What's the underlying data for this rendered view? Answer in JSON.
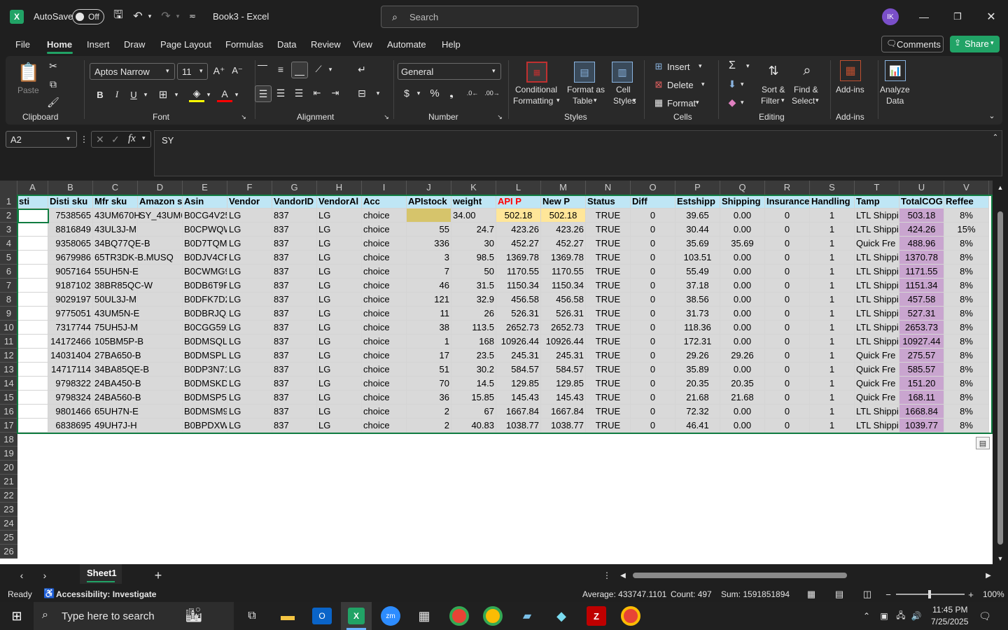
{
  "titlebar": {
    "autosave_label": "AutoSave",
    "autosave_state": "Off",
    "doc_title": "Book3  -  Excel",
    "search_placeholder": "Search",
    "avatar_initials": "IK"
  },
  "menu": {
    "tabs": [
      "File",
      "Home",
      "Insert",
      "Draw",
      "Page Layout",
      "Formulas",
      "Data",
      "Review",
      "View",
      "Automate",
      "Help"
    ],
    "active": "Home",
    "comments_label": "Comments",
    "share_label": "Share"
  },
  "ribbon": {
    "clipboard": {
      "paste": "Paste",
      "group": "Clipboard"
    },
    "font": {
      "name": "Aptos Narrow",
      "size": "11",
      "group": "Font"
    },
    "alignment": {
      "group": "Alignment"
    },
    "number": {
      "format": "General",
      "group": "Number"
    },
    "styles": {
      "conditional_1": "Conditional",
      "conditional_2": "Formatting",
      "format_table_1": "Format as",
      "format_table_2": "Table",
      "cell_styles_1": "Cell",
      "cell_styles_2": "Styles",
      "group": "Styles"
    },
    "cells": {
      "insert": "Insert",
      "delete": "Delete",
      "format": "Format",
      "group": "Cells"
    },
    "editing": {
      "sort_1": "Sort &",
      "sort_2": "Filter",
      "find_1": "Find &",
      "find_2": "Select",
      "group": "Editing"
    },
    "addins": {
      "label": "Add-ins",
      "group": "Add-ins"
    },
    "analyze": {
      "label_1": "Analyze",
      "label_2": "Data"
    }
  },
  "formula_bar": {
    "name_box": "A2",
    "formula": "SY"
  },
  "columns": [
    "A",
    "B",
    "C",
    "D",
    "E",
    "F",
    "G",
    "H",
    "I",
    "J",
    "K",
    "L",
    "M",
    "N",
    "O",
    "P",
    "Q",
    "R",
    "S",
    "T",
    "U",
    "V"
  ],
  "headers": [
    "sti",
    "Disti sku",
    "Mfr sku",
    "Amazon s",
    "Asin",
    "Vendor",
    "VandorID",
    "VendorAl",
    "Acc",
    "APIstock",
    "weight",
    "API P",
    "New P",
    "Status",
    "Diff",
    "Estshipp",
    "Shipping",
    "Insurance",
    "Handling",
    "Tamp",
    "TotalCOG",
    "Reffee"
  ],
  "rows": [
    [
      "",
      "7538565",
      "43UM670H",
      "SY_43UM6",
      "B0CG4V25",
      "LG",
      "837",
      "LG",
      "choice",
      "",
      "34.00",
      "502.18",
      "502.18",
      "TRUE",
      "0",
      "39.65",
      "0.00",
      "0",
      "1",
      "LTL Shippi",
      "503.18",
      "8%"
    ],
    [
      "",
      "8816849",
      "43UL3J-M",
      "",
      "B0CPWQW",
      "LG",
      "837",
      "LG",
      "choice",
      "55",
      "24.7",
      "423.26",
      "423.26",
      "TRUE",
      "0",
      "30.44",
      "0.00",
      "0",
      "1",
      "LTL Shippi",
      "424.26",
      "15%"
    ],
    [
      "",
      "9358065",
      "34BQ77QE-B",
      "",
      "B0D7TQM",
      "LG",
      "837",
      "LG",
      "choice",
      "336",
      "30",
      "452.27",
      "452.27",
      "TRUE",
      "0",
      "35.69",
      "35.69",
      "0",
      "1",
      "Quick Fre",
      "488.96",
      "8%"
    ],
    [
      "",
      "9679986",
      "65TR3DK-B.MUSQ",
      "",
      "B0DJV4CF",
      "LG",
      "837",
      "LG",
      "choice",
      "3",
      "98.5",
      "1369.78",
      "1369.78",
      "TRUE",
      "0",
      "103.51",
      "0.00",
      "0",
      "1",
      "LTL Shippi",
      "1370.78",
      "8%"
    ],
    [
      "",
      "9057164",
      "55UH5N-E",
      "",
      "B0CWMG9",
      "LG",
      "837",
      "LG",
      "choice",
      "7",
      "50",
      "1170.55",
      "1170.55",
      "TRUE",
      "0",
      "55.49",
      "0.00",
      "0",
      "1",
      "LTL Shippi",
      "1171.55",
      "8%"
    ],
    [
      "",
      "9187102",
      "38BR85QC-W",
      "",
      "B0DB6T9R",
      "LG",
      "837",
      "LG",
      "choice",
      "46",
      "31.5",
      "1150.34",
      "1150.34",
      "TRUE",
      "0",
      "37.18",
      "0.00",
      "0",
      "1",
      "LTL Shippi",
      "1151.34",
      "8%"
    ],
    [
      "",
      "9029197",
      "50UL3J-M",
      "",
      "B0DFK7D2",
      "LG",
      "837",
      "LG",
      "choice",
      "121",
      "32.9",
      "456.58",
      "456.58",
      "TRUE",
      "0",
      "38.56",
      "0.00",
      "0",
      "1",
      "LTL Shippi",
      "457.58",
      "8%"
    ],
    [
      "",
      "9775051",
      "43UM5N-E",
      "",
      "B0DBRJQ2",
      "LG",
      "837",
      "LG",
      "choice",
      "11",
      "26",
      "526.31",
      "526.31",
      "TRUE",
      "0",
      "31.73",
      "0.00",
      "0",
      "1",
      "LTL Shippi",
      "527.31",
      "8%"
    ],
    [
      "",
      "7317744",
      "75UH5J-M",
      "",
      "B0CGG592",
      "LG",
      "837",
      "LG",
      "choice",
      "38",
      "113.5",
      "2652.73",
      "2652.73",
      "TRUE",
      "0",
      "118.36",
      "0.00",
      "0",
      "1",
      "LTL Shippi",
      "2653.73",
      "8%"
    ],
    [
      "",
      "14172466",
      "105BM5P-B",
      "",
      "B0DMSQL",
      "LG",
      "837",
      "LG",
      "choice",
      "1",
      "168",
      "10926.44",
      "10926.44",
      "TRUE",
      "0",
      "172.31",
      "0.00",
      "0",
      "1",
      "LTL Shippi",
      "10927.44",
      "8%"
    ],
    [
      "",
      "14031404",
      "27BA650-B",
      "",
      "B0DMSPL7",
      "LG",
      "837",
      "LG",
      "choice",
      "17",
      "23.5",
      "245.31",
      "245.31",
      "TRUE",
      "0",
      "29.26",
      "29.26",
      "0",
      "1",
      "Quick Fre",
      "275.57",
      "8%"
    ],
    [
      "",
      "14717114",
      "34BA85QE-B",
      "",
      "B0DP3N71",
      "LG",
      "837",
      "LG",
      "choice",
      "51",
      "30.2",
      "584.57",
      "584.57",
      "TRUE",
      "0",
      "35.89",
      "0.00",
      "0",
      "1",
      "Quick Fre",
      "585.57",
      "8%"
    ],
    [
      "",
      "9798322",
      "24BA450-B",
      "",
      "B0DMSKD",
      "LG",
      "837",
      "LG",
      "choice",
      "70",
      "14.5",
      "129.85",
      "129.85",
      "TRUE",
      "0",
      "20.35",
      "20.35",
      "0",
      "1",
      "Quick Fre",
      "151.20",
      "8%"
    ],
    [
      "",
      "9798324",
      "24BA560-B",
      "",
      "B0DMSP52",
      "LG",
      "837",
      "LG",
      "choice",
      "36",
      "15.85",
      "145.43",
      "145.43",
      "TRUE",
      "0",
      "21.68",
      "21.68",
      "0",
      "1",
      "Quick Fre",
      "168.11",
      "8%"
    ],
    [
      "",
      "9801466",
      "65UH7N-E",
      "",
      "B0DMSM9",
      "LG",
      "837",
      "LG",
      "choice",
      "2",
      "67",
      "1667.84",
      "1667.84",
      "TRUE",
      "0",
      "72.32",
      "0.00",
      "0",
      "1",
      "LTL Shippi",
      "1668.84",
      "8%"
    ],
    [
      "",
      "6838695",
      "49UH7J-H",
      "",
      "B0BPDXW",
      "LG",
      "837",
      "LG",
      "choice",
      "2",
      "40.83",
      "1038.77",
      "1038.77",
      "TRUE",
      "0",
      "46.41",
      "0.00",
      "0",
      "1",
      "LTL Shippi",
      "1039.77",
      "8%"
    ]
  ],
  "row_numbers": [
    "1",
    "2",
    "3",
    "4",
    "5",
    "6",
    "7",
    "8",
    "9",
    "10",
    "11",
    "12",
    "13",
    "14",
    "15",
    "16",
    "17",
    "18",
    "19",
    "20",
    "21",
    "22",
    "23",
    "24",
    "25",
    "26"
  ],
  "sheet": {
    "tab": "Sheet1"
  },
  "status": {
    "ready": "Ready",
    "accessibility": "Accessibility: Investigate",
    "average": "Average: 433747.1101",
    "count": "Count: 497",
    "sum": "Sum: 1591851894",
    "zoom": "100%"
  },
  "taskbar": {
    "search_placeholder": "Type here to search",
    "time": "11:45 PM",
    "date": "7/25/2025"
  },
  "colors": {
    "accent_green": "#21a366",
    "header_red_text": "#ff0000",
    "yellow_fill": "#ffe699",
    "purple_fill": "#c9a5cf",
    "apistock_fill": "#d6c46b"
  }
}
